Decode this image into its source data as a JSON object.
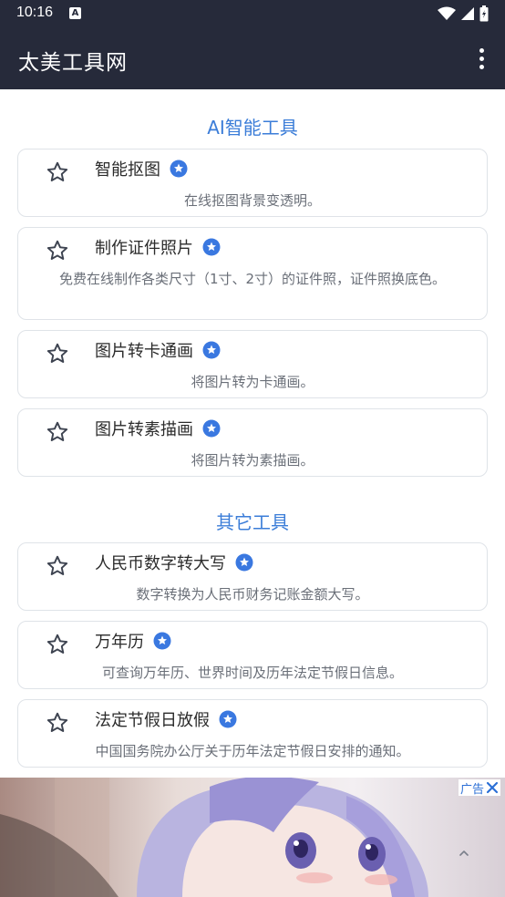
{
  "status_bar": {
    "time": "10:16",
    "notification_icon": "A"
  },
  "app_bar": {
    "title": "太美工具网",
    "menu_icon": "more-vertical-icon"
  },
  "sections": [
    {
      "heading": "AI智能工具",
      "tools": [
        {
          "title": "智能抠图",
          "description": "在线抠图背景变透明。"
        },
        {
          "title": "制作证件照片",
          "description": "免费在线制作各类尺寸（1寸、2寸）的证件照，证件照换底色。"
        },
        {
          "title": "图片转卡通画",
          "description": "将图片转为卡通画。"
        },
        {
          "title": "图片转素描画",
          "description": "将图片转为素描画。"
        }
      ]
    },
    {
      "heading": "其它工具",
      "tools": [
        {
          "title": "人民币数字转大写",
          "description": "数字转换为人民币财务记账金额大写。"
        },
        {
          "title": "万年历",
          "description": "可查询万年历、世界时间及历年法定节假日信息。"
        },
        {
          "title": "法定节假日放假",
          "description": "中国国务院办公厅关于历年法定节假日安排的通知。"
        }
      ]
    }
  ],
  "ad": {
    "label": "广告"
  },
  "colors": {
    "app_bar": "#262a3a",
    "accent": "#3b7dd8",
    "badge": "#3a78e0",
    "card_border": "#dfe3e8"
  }
}
